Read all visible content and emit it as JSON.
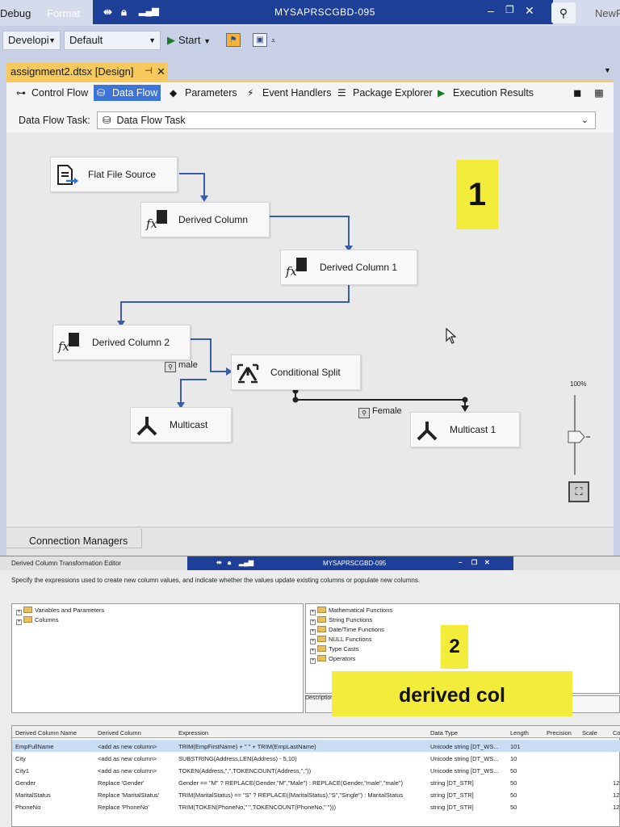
{
  "vs": {
    "menu": [
      "Debug",
      "Format"
    ],
    "window_title": "MYSAPRSCGBD-095",
    "new_feature_text": "NewF",
    "toolbar": {
      "config": "Developi",
      "platform": "Default",
      "start": "Start"
    },
    "doc_tab": "assignment2.dtsx [Design]",
    "tabs": [
      "Control Flow",
      "Data Flow",
      "Parameters",
      "Event Handlers",
      "Package Explorer",
      "Execution Results"
    ],
    "active_tab": "Data Flow",
    "task_label": "Data Flow Task:",
    "task_value": "Data Flow Task",
    "nodes": {
      "flat_file_source": "Flat File Source",
      "derived_column": "Derived Column",
      "derived_column_1": "Derived Column 1",
      "derived_column_2": "Derived Column 2",
      "conditional_split": "Conditional Split",
      "multicast": "Multicast",
      "multicast_1": "Multicast 1"
    },
    "path_labels": {
      "male": "male",
      "female": "Female"
    },
    "annotation_1": "1",
    "zoom": "100%",
    "connection_managers": "Connection Managers"
  },
  "editor": {
    "title": "Derived Column Transformation Editor",
    "window_title": "MYSAPRSCGBD-095",
    "instructions": "Specify the expressions used to create new column values, and indicate whether the values update existing columns or populate new columns.",
    "left_tree": [
      "Variables and Parameters",
      "Columns"
    ],
    "right_tree": [
      "Mathematical Functions",
      "String Functions",
      "Date/Time Functions",
      "NULL Functions",
      "Type Casts",
      "Operators"
    ],
    "description_label": "Description:",
    "annotation_2": "2",
    "annotation_derived": "derived col",
    "headers": [
      "Derived Column Name",
      "Derived Column",
      "Expression",
      "Data Type",
      "Length",
      "Precision",
      "Scale",
      "Co"
    ],
    "rows": [
      [
        "EmpFullName",
        "<add as new column>",
        "TRIM(EmpFirstName) + \" \" + TRIM(EmpLastName)",
        "Unicode string [DT_WS...",
        "101",
        "",
        "",
        ""
      ],
      [
        "City",
        "<add as new column>",
        "SUBSTRING(Address,LEN(Address) - 5,10)",
        "Unicode string [DT_WS...",
        "10",
        "",
        "",
        ""
      ],
      [
        "City1",
        "<add as new column>",
        "TOKEN(Address,\",\",TOKENCOUNT(Address,\",\"))",
        "Unicode string [DT_WS...",
        "50",
        "",
        "",
        ""
      ],
      [
        "Gender",
        "Replace 'Gender'",
        "Gender == \"M\" ? REPLACE(Gender,\"M\",\"Male\") : REPLACE(Gender,\"male\",\"male\")",
        "string [DT_STR]",
        "50",
        "",
        "",
        "12"
      ],
      [
        "MaritalStatus",
        "Replace 'MaritalStatus'",
        "TRIM(MaritalStatus) == \"S\" ? REPLACE((MaritalStatus),\"S\",\"Single\") : MaritalStatus",
        "string [DT_STR]",
        "50",
        "",
        "",
        "12"
      ],
      [
        "PhoneNo",
        "Replace 'PhoneNo'",
        "TRIM(TOKEN(PhoneNo,\" \",TOKENCOUNT(PhoneNo,\" \")))",
        "string [DT_STR]",
        "50",
        "",
        "",
        "12"
      ]
    ],
    "selected_row": 0
  }
}
